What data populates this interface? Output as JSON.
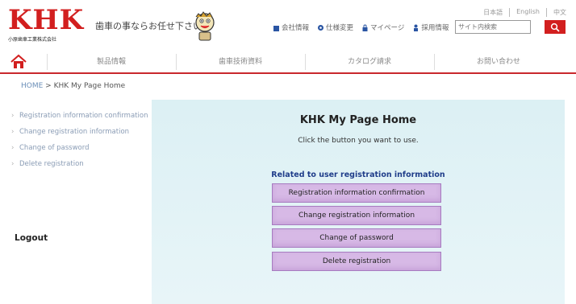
{
  "header": {
    "logo_text": "KHK",
    "logo_subtext": "小原歯車工業株式会社",
    "tagline": "歯車の事ならお任せ下さい",
    "top_links": [
      {
        "label": "会社情報",
        "icon": "building-icon",
        "color": "#2a55a3"
      },
      {
        "label": "仕様変更",
        "icon": "gear-icon",
        "color": "#2a55a3"
      },
      {
        "label": "マイページ",
        "icon": "lock-icon",
        "color": "#2a55a3"
      },
      {
        "label": "採用情報",
        "icon": "person-icon",
        "color": "#2a55a3"
      }
    ],
    "languages": [
      "日本語",
      "English",
      "中文"
    ],
    "search_placeholder": "サイト内検索"
  },
  "nav": {
    "items": [
      "製品情報",
      "歯車技術資料",
      "カタログ請求",
      "お問い合わせ"
    ]
  },
  "breadcrumb": {
    "home": "HOME",
    "separator": " > ",
    "current": "KHK My Page Home"
  },
  "sidebar": {
    "items": [
      "Registration information confirmation",
      "Change registration information",
      "Change of password",
      "Delete registration"
    ],
    "logout": "Logout"
  },
  "main": {
    "title": "KHK My Page Home",
    "instruction": "Click the button you want to use.",
    "section_heading": "Related to user registration information",
    "buttons": [
      "Registration information confirmation",
      "Change registration information",
      "Change of password",
      "Delete registration"
    ]
  },
  "colors": {
    "brand_red": "#d21f1f",
    "panel_bg": "#dcf0f4",
    "button_bg": "#d7b9e6",
    "heading_blue": "#1f3d8a"
  }
}
